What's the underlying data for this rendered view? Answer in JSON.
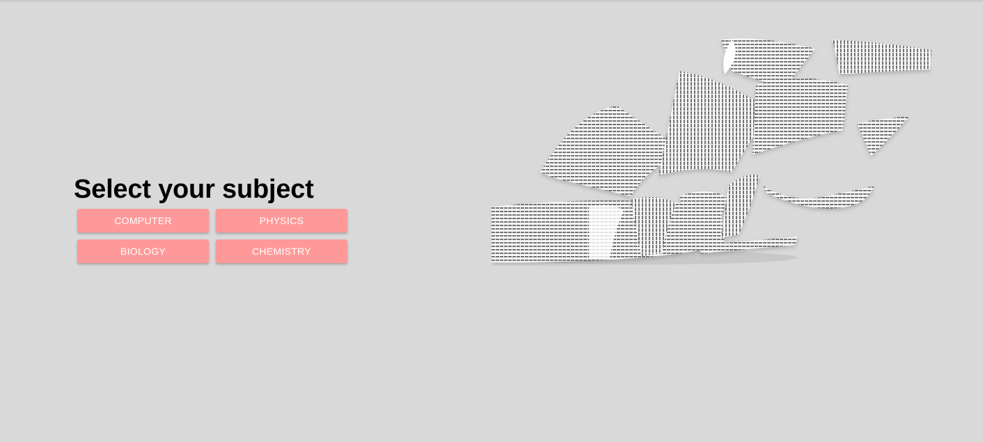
{
  "main": {
    "title": "Select your subject",
    "subjects": [
      {
        "label": "COMPUTER"
      },
      {
        "label": "PHYSICS"
      },
      {
        "label": "BIOLOGY"
      },
      {
        "label": "CHEMISTRY"
      }
    ]
  },
  "hero": {
    "icon": "flying-papers-illustration"
  },
  "colors": {
    "background": "#d9d9d9",
    "button": "#ff9999",
    "button_text": "#ffffff",
    "title": "#000000"
  }
}
